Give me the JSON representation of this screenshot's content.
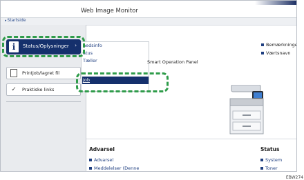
{
  "header": {
    "app_title": "Web Image Monitor",
    "breadcrumb": "Startside"
  },
  "sidebar": {
    "status_button": {
      "icon_letter": "i",
      "label": "Status/Oplysninger"
    },
    "print_job_button": {
      "label": "Printjob/lagret fil"
    },
    "links_button": {
      "label": "Praktiske links"
    }
  },
  "submenu": {
    "items": [
      "hedsinfo",
      "atus",
      "Tæller",
      "Job"
    ],
    "selected_index": 3
  },
  "main": {
    "panel_text": "Smart Operation Panel",
    "legend": [
      "Bemærkninger",
      "Værtsnavn"
    ]
  },
  "bottom": {
    "warning": {
      "title": "Advarsel",
      "links": [
        "Advarsel",
        "Meddelelser (Denne"
      ]
    },
    "status": {
      "title": "Status",
      "links": [
        "System",
        "Toner"
      ]
    }
  },
  "figure_code": "EBW274",
  "colors": {
    "accent_navy": "#15306c",
    "callout_green": "#2f9c4a",
    "link_blue": "#1f3f80",
    "sidebar_bg": "#e9ebee"
  },
  "icons": {
    "status": "info-icon",
    "print_job": "document-icon",
    "links": "thumbs-up-icon",
    "submenu_chevron": "chevron-right-icon"
  }
}
